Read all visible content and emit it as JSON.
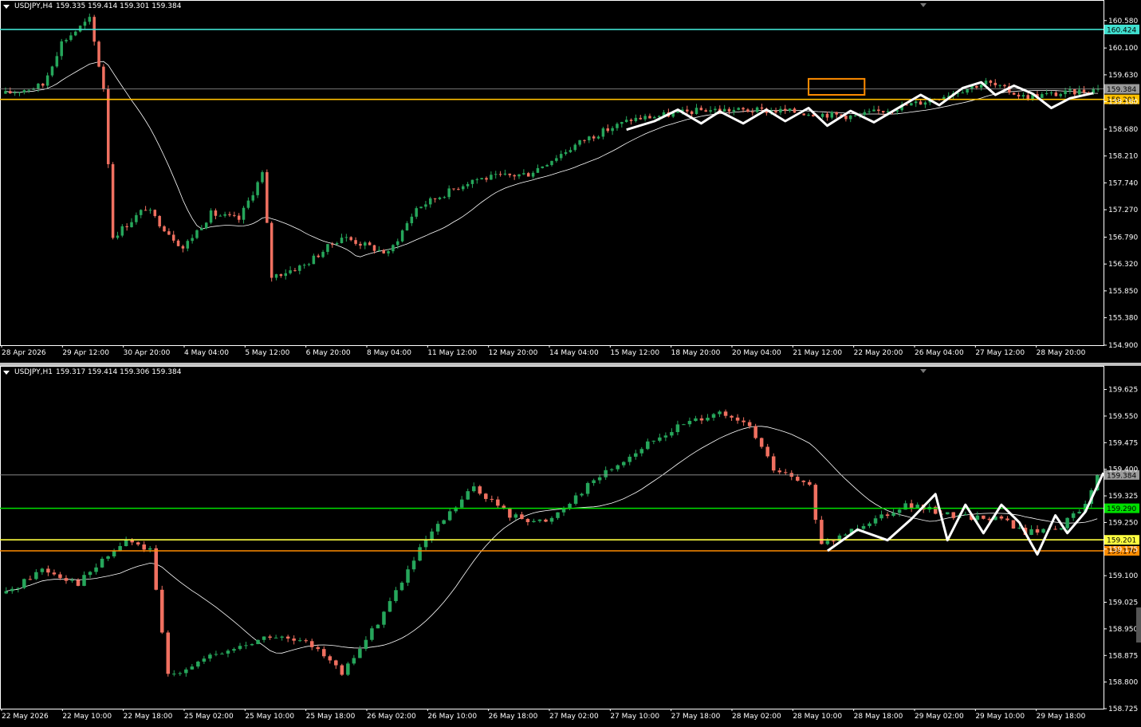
{
  "chart_data": [
    {
      "type": "candlestick",
      "symbol_header": "USDJPY,H4",
      "ohlc_header": "159.335 159.414 159.301 159.384",
      "ylim": [
        154.9,
        160.8
      ],
      "y_ticks": [
        "160.580",
        "160.100",
        "159.630",
        "159.160",
        "158.680",
        "158.210",
        "157.740",
        "157.270",
        "156.790",
        "156.320",
        "155.850",
        "155.380",
        "154.900"
      ],
      "y_tick_values": [
        160.58,
        160.1,
        159.63,
        159.16,
        158.68,
        158.21,
        157.74,
        157.27,
        156.79,
        156.32,
        155.85,
        155.38,
        154.9
      ],
      "x_ticks": [
        "28 Apr 2026",
        "29 Apr 12:00",
        "30 Apr 20:00",
        "4 May 04:00",
        "5 May 12:00",
        "6 May 20:00",
        "8 May 04:00",
        "11 May 12:00",
        "12 May 20:00",
        "14 May 04:00",
        "15 May 12:00",
        "18 May 20:00",
        "20 May 04:00",
        "21 May 12:00",
        "22 May 20:00",
        "26 May 04:00",
        "27 May 12:00",
        "28 May 20:00"
      ],
      "levels": [
        {
          "label": "160.424",
          "value": 160.424,
          "color": "#40e0d0"
        },
        {
          "label": "159.384",
          "value": 159.384,
          "color": "#9a9a9a"
        },
        {
          "label": "159.201",
          "value": 159.201,
          "color": "#ffc000"
        }
      ],
      "colors": {
        "bull": "#26a65b",
        "bear": "#f07060",
        "ma": "#ffffff",
        "zigzag": "#ffffff",
        "box": "#ff8c00",
        "bg": "#000000",
        "axis": "#ffffff"
      },
      "candle_range": [
        0,
        180
      ],
      "highlight_box": {
        "from_candle": 172,
        "to_candle": 184,
        "low": 159.28,
        "high": 159.56
      },
      "zigzag": [
        [
          133,
          158.67
        ],
        [
          139,
          158.82
        ],
        [
          144,
          159.02
        ],
        [
          149,
          158.78
        ],
        [
          153,
          158.99
        ],
        [
          158,
          158.78
        ],
        [
          163,
          159.02
        ],
        [
          167,
          158.82
        ],
        [
          172,
          159.05
        ],
        [
          176,
          158.74
        ],
        [
          181,
          159.0
        ],
        [
          186,
          158.8
        ],
        [
          191,
          159.04
        ],
        [
          196,
          159.28
        ],
        [
          200,
          159.1
        ],
        [
          205,
          159.4
        ],
        [
          209,
          159.5
        ],
        [
          212,
          159.28
        ],
        [
          216,
          159.44
        ],
        [
          220,
          159.3
        ],
        [
          224,
          159.05
        ],
        [
          228,
          159.22
        ],
        [
          233,
          159.31
        ]
      ],
      "key_points": [
        {
          "x": 0,
          "y": 159.3
        },
        {
          "x": 8,
          "y": 159.45
        },
        {
          "x": 12,
          "y": 160.2
        },
        {
          "x": 18,
          "y": 160.6
        },
        {
          "x": 21,
          "y": 159.4
        },
        {
          "x": 23,
          "y": 156.8
        },
        {
          "x": 30,
          "y": 157.3
        },
        {
          "x": 38,
          "y": 156.6
        },
        {
          "x": 44,
          "y": 157.2
        },
        {
          "x": 50,
          "y": 157.1
        },
        {
          "x": 55,
          "y": 157.9
        },
        {
          "x": 57,
          "y": 156.1
        },
        {
          "x": 64,
          "y": 156.3
        },
        {
          "x": 72,
          "y": 156.8
        },
        {
          "x": 82,
          "y": 156.5
        },
        {
          "x": 88,
          "y": 157.3
        },
        {
          "x": 100,
          "y": 157.8
        },
        {
          "x": 112,
          "y": 157.9
        },
        {
          "x": 124,
          "y": 158.5
        },
        {
          "x": 134,
          "y": 158.85
        },
        {
          "x": 150,
          "y": 159.02
        },
        {
          "x": 166,
          "y": 159.0
        },
        {
          "x": 182,
          "y": 158.9
        },
        {
          "x": 196,
          "y": 159.15
        },
        {
          "x": 210,
          "y": 159.5
        },
        {
          "x": 218,
          "y": 159.25
        },
        {
          "x": 226,
          "y": 159.3
        },
        {
          "x": 234,
          "y": 159.384
        }
      ],
      "bar_count": 235,
      "seed": 17
    },
    {
      "type": "candlestick",
      "symbol_header": "USDJPY,H1",
      "ohlc_header": "159.317 159.414 159.306 159.384",
      "ylim": [
        158.725,
        159.66
      ],
      "y_ticks": [
        "159.625",
        "159.550",
        "159.475",
        "159.400",
        "159.325",
        "159.250",
        "159.175",
        "159.100",
        "159.025",
        "158.950",
        "158.875",
        "158.800",
        "158.725"
      ],
      "y_tick_values": [
        159.625,
        159.55,
        159.475,
        159.4,
        159.325,
        159.25,
        159.175,
        159.1,
        159.025,
        158.95,
        158.875,
        158.8,
        158.725
      ],
      "x_ticks": [
        "22 May 2026",
        "22 May 10:00",
        "22 May 18:00",
        "25 May 02:00",
        "25 May 10:00",
        "25 May 18:00",
        "26 May 02:00",
        "26 May 10:00",
        "26 May 18:00",
        "27 May 02:00",
        "27 May 10:00",
        "27 May 18:00",
        "28 May 02:00",
        "28 May 10:00",
        "28 May 18:00",
        "29 May 02:00",
        "29 May 10:00",
        "29 May 18:00"
      ],
      "levels": [
        {
          "label": "159.384",
          "value": 159.384,
          "color": "#9a9a9a"
        },
        {
          "label": "159.290",
          "value": 159.29,
          "color": "#00e000"
        },
        {
          "label": "159.201",
          "value": 159.201,
          "color": "#ffff40"
        },
        {
          "label": "159.170",
          "value": 159.17,
          "color": "#ff8c00"
        }
      ],
      "colors": {
        "bull": "#26a65b",
        "bear": "#f07060",
        "ma": "#ffffff",
        "zigzag": "#ffffff",
        "box": "#00e000",
        "bg": "#000000",
        "axis": "#ffffff"
      },
      "highlight_box": {
        "from_candle": 222,
        "to_candle": 236,
        "low": 159.22,
        "high": 159.268
      },
      "zigzag": [
        [
          137,
          159.17
        ],
        [
          142,
          159.23
        ],
        [
          147,
          159.2
        ],
        [
          151,
          159.26
        ],
        [
          155,
          159.33
        ],
        [
          157,
          159.2
        ],
        [
          160,
          159.3
        ],
        [
          163,
          159.22
        ],
        [
          166,
          159.3
        ],
        [
          169,
          159.25
        ],
        [
          172,
          159.16
        ],
        [
          175,
          159.27
        ],
        [
          177,
          159.22
        ],
        [
          180,
          159.28
        ],
        [
          183,
          159.39
        ]
      ],
      "key_points": [
        {
          "x": 0,
          "y": 159.05
        },
        {
          "x": 6,
          "y": 159.12
        },
        {
          "x": 12,
          "y": 159.08
        },
        {
          "x": 20,
          "y": 159.2
        },
        {
          "x": 24,
          "y": 159.17
        },
        {
          "x": 27,
          "y": 158.82
        },
        {
          "x": 34,
          "y": 158.87
        },
        {
          "x": 44,
          "y": 158.93
        },
        {
          "x": 52,
          "y": 158.9
        },
        {
          "x": 56,
          "y": 158.82
        },
        {
          "x": 62,
          "y": 158.97
        },
        {
          "x": 70,
          "y": 159.2
        },
        {
          "x": 78,
          "y": 159.35
        },
        {
          "x": 84,
          "y": 159.27
        },
        {
          "x": 90,
          "y": 159.25
        },
        {
          "x": 98,
          "y": 159.37
        },
        {
          "x": 106,
          "y": 159.46
        },
        {
          "x": 112,
          "y": 159.52
        },
        {
          "x": 118,
          "y": 159.56
        },
        {
          "x": 124,
          "y": 159.52
        },
        {
          "x": 128,
          "y": 159.4
        },
        {
          "x": 134,
          "y": 159.35
        },
        {
          "x": 136,
          "y": 159.18
        },
        {
          "x": 142,
          "y": 159.24
        },
        {
          "x": 150,
          "y": 159.3
        },
        {
          "x": 158,
          "y": 159.27
        },
        {
          "x": 166,
          "y": 159.26
        },
        {
          "x": 170,
          "y": 159.22
        },
        {
          "x": 176,
          "y": 159.24
        },
        {
          "x": 180,
          "y": 159.3
        },
        {
          "x": 182,
          "y": 159.384
        }
      ],
      "bar_count": 183,
      "seed": 41
    }
  ]
}
